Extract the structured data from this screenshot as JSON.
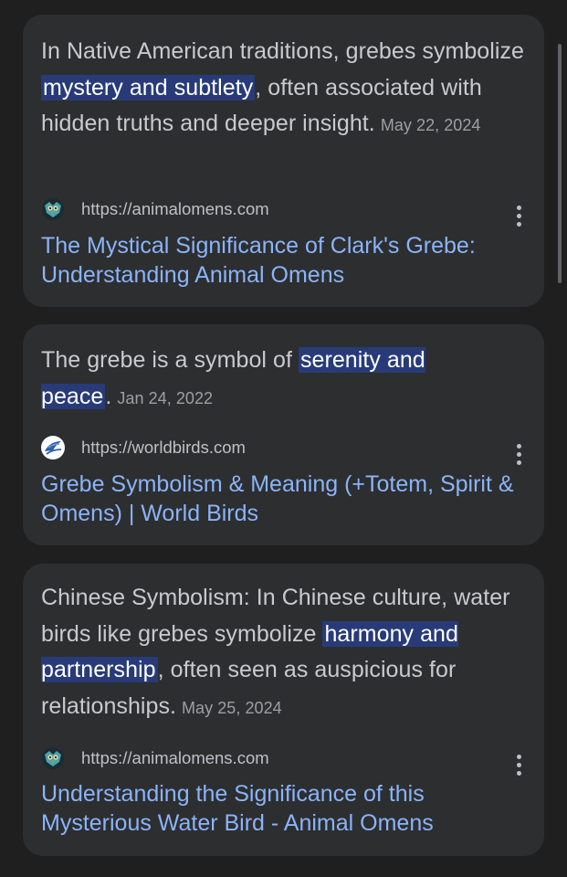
{
  "results": [
    {
      "snippet_pre": "In Native American traditions, grebes symbolize ",
      "highlight": "mystery and subtlety",
      "snippet_post": ", often associated with hidden truths and deeper insight.",
      "date": "May 22, 2024",
      "favicon": "animalomens-owl-icon",
      "url": "https://animalomens.com",
      "title": "The Mystical Significance of Clark's Grebe: Understanding Animal Omens"
    },
    {
      "snippet_pre": "The grebe is a symbol of ",
      "highlight": "serenity and peace",
      "snippet_post": ".",
      "date": "Jan 24, 2022",
      "favicon": "worldbirds-bird-icon",
      "url": "https://worldbirds.com",
      "title": "Grebe Symbolism & Meaning (+Totem, Spirit & Omens) | World Birds"
    },
    {
      "snippet_pre": "Chinese Symbolism: In Chinese culture, water birds like grebes symbolize ",
      "highlight": "harmony and partnership",
      "snippet_post": ", often seen as auspicious for relationships.",
      "date": "May 25, 2024",
      "favicon": "animalomens-owl-icon",
      "url": "https://animalomens.com",
      "title": "Understanding the Significance of this Mysterious Water Bird - Animal Omens"
    }
  ],
  "colors": {
    "background": "#1f1f1f",
    "card": "#2d2e30",
    "link": "#8ab4f8",
    "highlight": "#283b78"
  }
}
